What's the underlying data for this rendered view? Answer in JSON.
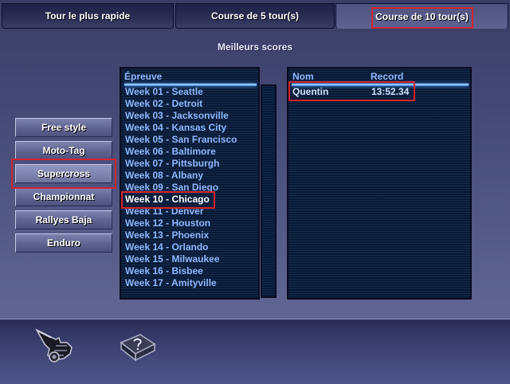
{
  "tabs": [
    {
      "label": "Tour le plus rapide",
      "active": false
    },
    {
      "label": "Course de 5 tour(s)",
      "active": false
    },
    {
      "label": "Course de 10 tour(s)",
      "active": true
    }
  ],
  "section_title": "Meilleurs scores",
  "modes": [
    {
      "label": "Free style",
      "selected": false
    },
    {
      "label": "Moto-Tag",
      "selected": false
    },
    {
      "label": "Supercross",
      "selected": true
    },
    {
      "label": "Championnat",
      "selected": false
    },
    {
      "label": "Rallyes Baja",
      "selected": false
    },
    {
      "label": "Enduro",
      "selected": false
    }
  ],
  "events_panel": {
    "header": "Épreuve",
    "items": [
      "Week 01 - Seattle",
      "Week 02 - Detroit",
      "Week 03 - Jacksonville",
      "Week 04 - Kansas City",
      "Week 05 - San Francisco",
      "Week 06 - Baltimore",
      "Week 07 - Pittsburgh",
      "Week 08 - Albany",
      "Week 09 - San Diego",
      "Week 10 - Chicago",
      "Week 11 - Denver",
      "Week 12 - Houston",
      "Week 13 - Phoenix",
      "Week 14 - Orlando",
      "Week 15 - Milwaukee",
      "Week 16 - Bisbee",
      "Week 17 - Amityville"
    ],
    "selected": "Week 10 - Chicago"
  },
  "scores_panel": {
    "col_name": "Nom",
    "col_record": "Record",
    "rows": [
      {
        "name": "Quentin",
        "record": "13:52.34"
      }
    ]
  },
  "bottom": {
    "back_icon": "pointing-hand-icon",
    "help_icon": "help-book-icon"
  },
  "colors": {
    "highlight": "#d3252f",
    "list_text": "#8db9ff",
    "header_text": "#8fb8ff",
    "panel_bg": "#0a1a34"
  }
}
